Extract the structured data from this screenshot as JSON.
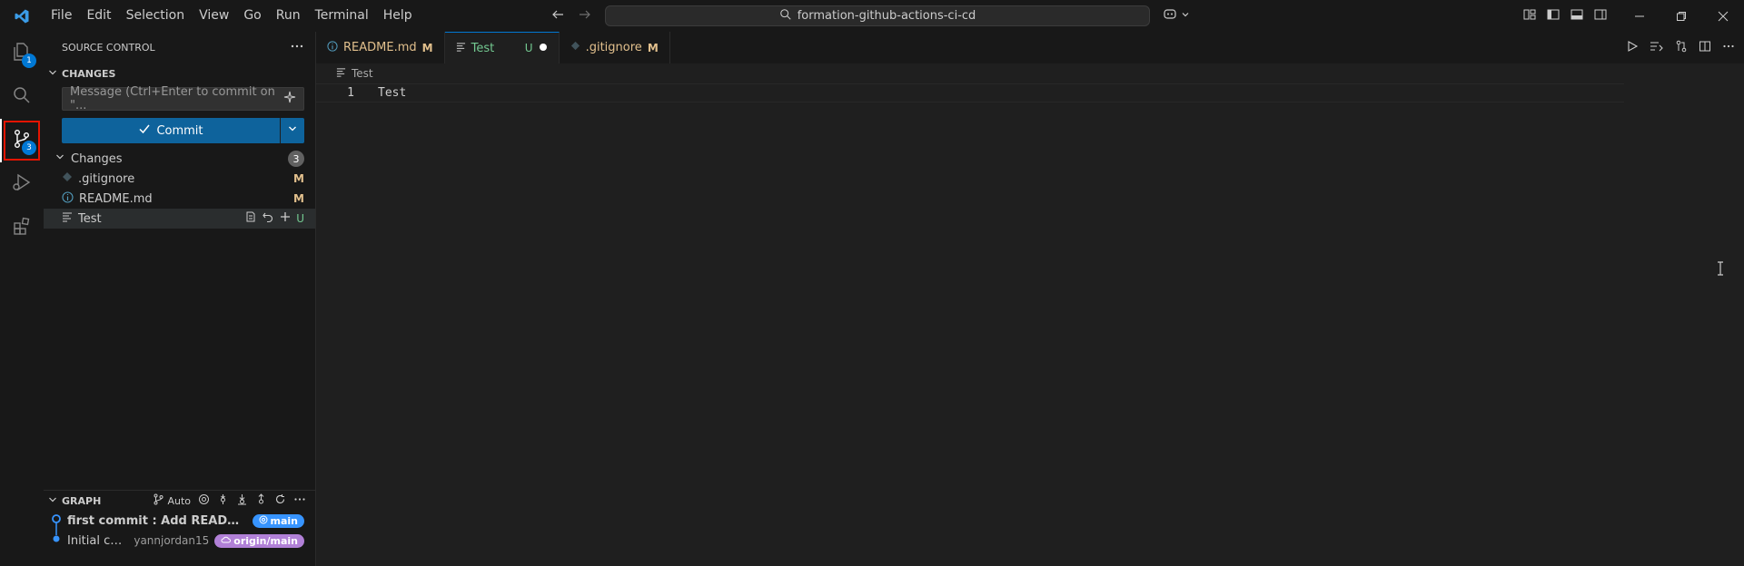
{
  "titlebar": {
    "menu": [
      "File",
      "Edit",
      "Selection",
      "View",
      "Go",
      "Run",
      "Terminal",
      "Help"
    ],
    "search_text": "formation-github-actions-ci-cd"
  },
  "activity_bar": {
    "explorer_badge": "1",
    "scm_badge": "3"
  },
  "sidebar": {
    "title": "SOURCE CONTROL",
    "changes_section": "CHANGES",
    "message_placeholder": "Message (Ctrl+Enter to commit on \"...",
    "commit_label": "Commit",
    "group_label": "Changes",
    "group_count": "3",
    "files": [
      {
        "name": ".gitignore",
        "status": "M"
      },
      {
        "name": "README.md",
        "status": "M"
      },
      {
        "name": "Test",
        "status": "U"
      }
    ],
    "graph": {
      "title": "GRAPH",
      "auto_label": "Auto",
      "commits": [
        {
          "message": "first commit : Add README.md an...",
          "author": "",
          "ref": "main"
        },
        {
          "message": "Initial commit",
          "author": "yannjordan15",
          "ref": "origin/main"
        }
      ]
    }
  },
  "editor": {
    "tabs": [
      {
        "label": "README.md",
        "status": "M"
      },
      {
        "label": "Test",
        "status": "U"
      },
      {
        "label": ".gitignore",
        "status": "M"
      }
    ],
    "breadcrumb": "Test",
    "lines": [
      {
        "number": "1",
        "text": "Test"
      }
    ]
  },
  "colors": {
    "accent": "#0078d4",
    "modified": "#e2c08d",
    "untracked": "#73c991",
    "highlight_box": "#e51400"
  }
}
